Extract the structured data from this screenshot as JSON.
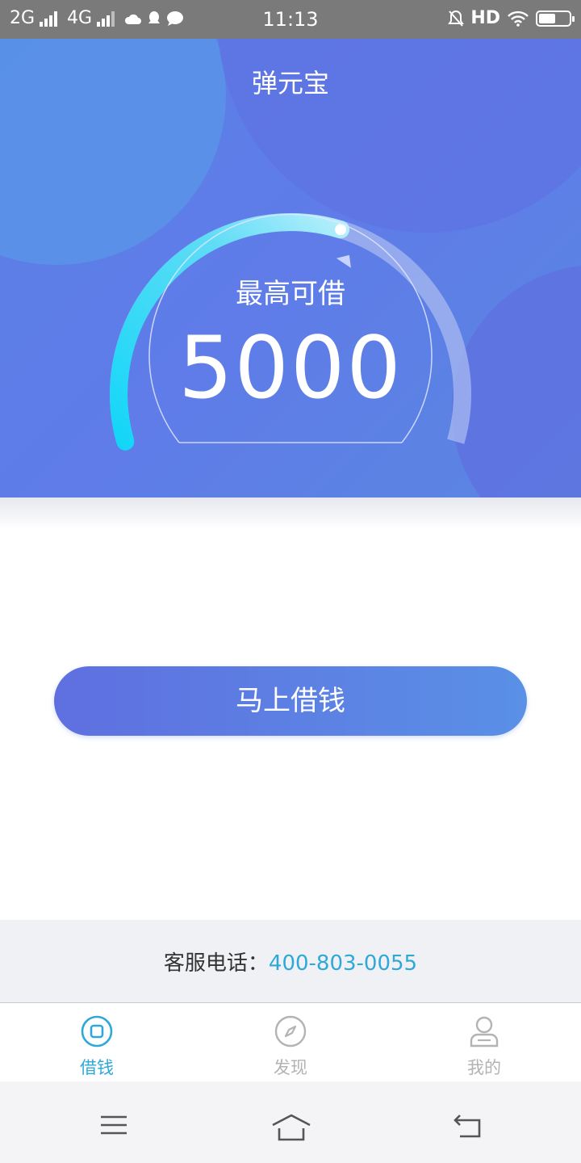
{
  "status_bar": {
    "carrier1": "2G",
    "carrier2": "4G",
    "time": "11:13",
    "hd": "HD",
    "battery_level": 0.55
  },
  "hero": {
    "title": "弹元宝",
    "gauge_label": "最高可借",
    "max_amount": "5000",
    "gauge_progress": 0.58
  },
  "action": {
    "borrow_label": "马上借钱"
  },
  "service": {
    "label": "客服电话：",
    "phone": "400-803-0055"
  },
  "tabs": [
    {
      "label": "借钱",
      "icon": "loan-icon",
      "active": true
    },
    {
      "label": "发现",
      "icon": "compass-icon",
      "active": false
    },
    {
      "label": "我的",
      "icon": "user-icon",
      "active": false
    }
  ],
  "colors": {
    "active_tab": "#2fa8d8",
    "inactive_tab": "#b3b3b3",
    "phone_link": "#2fa8d8"
  },
  "nav": {
    "icons": [
      "menu-icon",
      "home-icon",
      "back-icon"
    ]
  }
}
